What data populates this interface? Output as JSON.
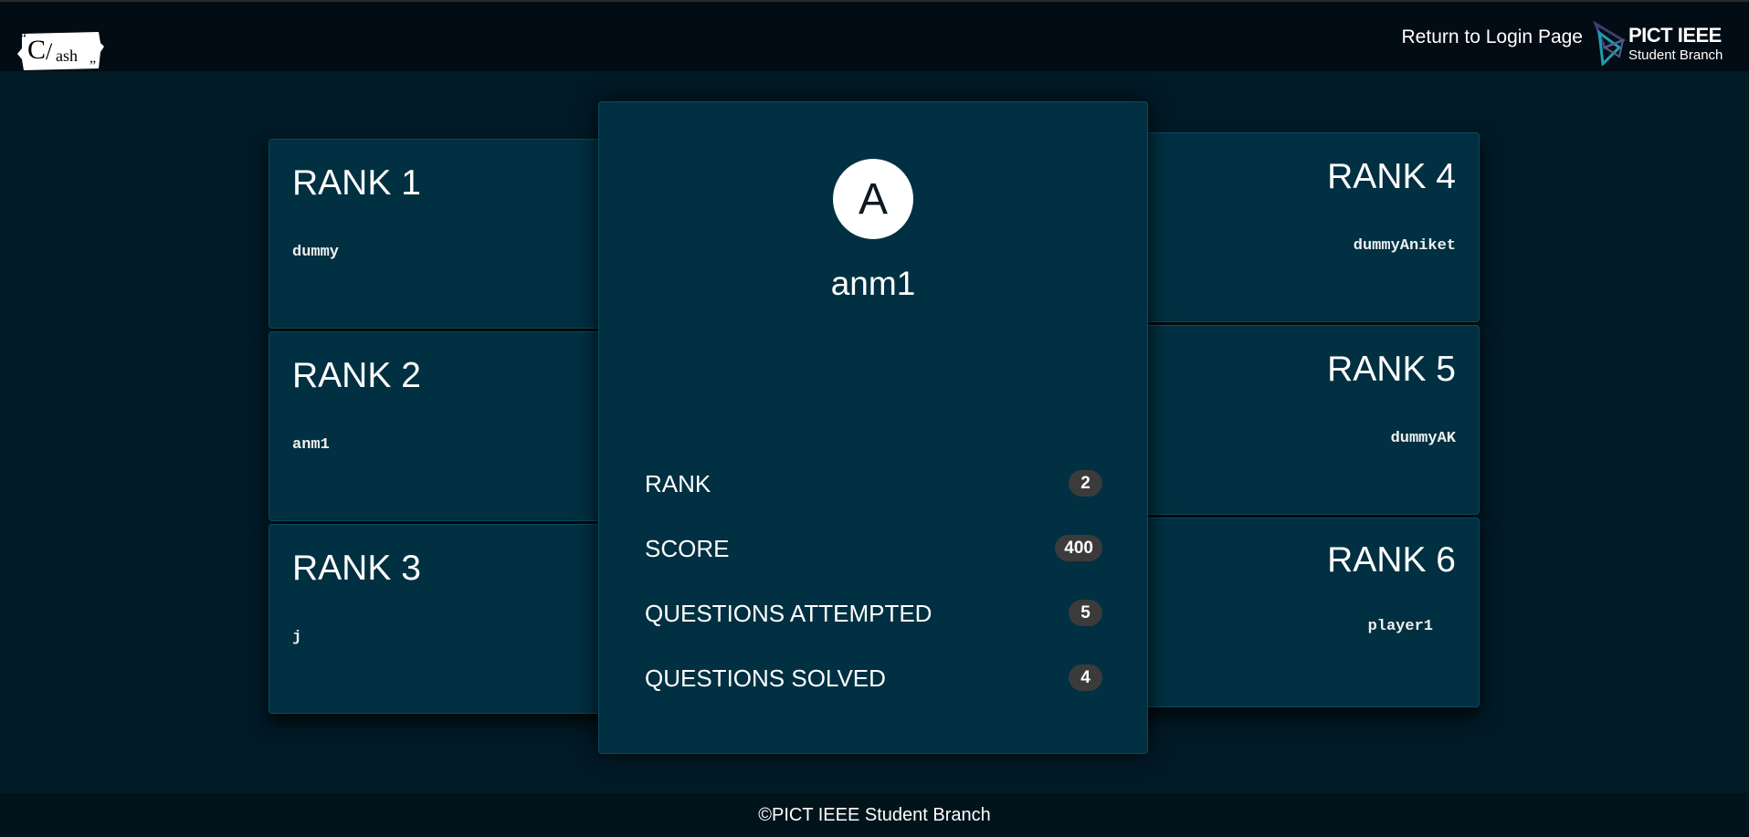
{
  "header": {
    "logo_text": "C/ash",
    "return_link": "Return to Login Page",
    "ieee_logo_title": "PICT IEEE",
    "ieee_logo_subtitle": "Student Branch"
  },
  "leaderboard": [
    {
      "rank_label": "RANK 1",
      "player": "dummy"
    },
    {
      "rank_label": "RANK 2",
      "player": "anm1"
    },
    {
      "rank_label": "RANK 3",
      "player": "j"
    },
    {
      "rank_label": "RANK 4",
      "player": "dummyAniket"
    },
    {
      "rank_label": "RANK 5",
      "player": "dummyAK"
    },
    {
      "rank_label": "RANK 6",
      "player": "player1"
    }
  ],
  "profile": {
    "avatar_letter": "A",
    "username": "anm1",
    "stats": [
      {
        "label": "RANK",
        "value": "2"
      },
      {
        "label": "SCORE",
        "value": "400"
      },
      {
        "label": "QUESTIONS ATTEMPTED",
        "value": "5"
      },
      {
        "label": "QUESTIONS SOLVED",
        "value": "4"
      }
    ]
  },
  "footer": {
    "text": "©PICT IEEE Student Branch"
  },
  "colors": {
    "background": "#001a26",
    "card": "#003041",
    "badge": "#3b3b3b",
    "topbar": "#020c14"
  }
}
